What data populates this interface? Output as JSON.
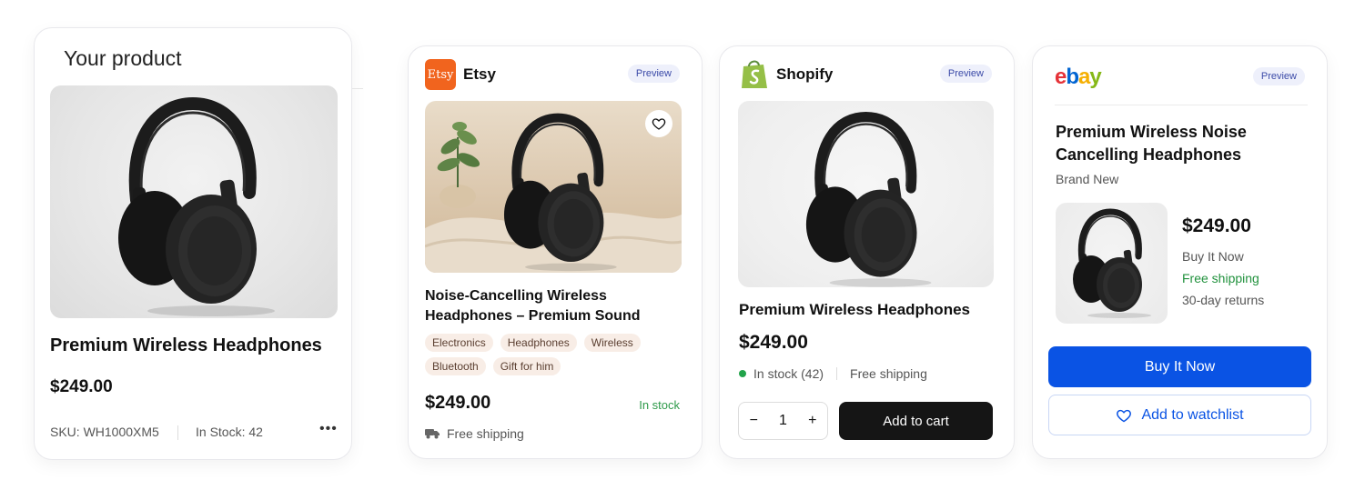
{
  "your_product": {
    "title": "Your product",
    "name": "Premium Wireless Headphones",
    "price": "$249.00",
    "sku": "SKU: WH1000XM5",
    "stock": "In Stock: 42",
    "more_icon": "more-horizontal-icon"
  },
  "etsy": {
    "brand": "Etsy",
    "logo_text": "Etsy",
    "preview": "Preview",
    "name": "Noise-Cancelling Wireless Headphones – Premium Sound",
    "tags": [
      "Electronics",
      "Headphones",
      "Wireless",
      "Bluetooth",
      "Gift for him"
    ],
    "price": "$249.00",
    "stock": "In stock",
    "shipping": "Free shipping",
    "brand_color": "#f1641e"
  },
  "shopify": {
    "brand": "Shopify",
    "preview": "Preview",
    "name": "Premium Wireless Headphones",
    "price": "$249.00",
    "stock": "In stock (42)",
    "shipping": "Free shipping",
    "qty": "1",
    "qty_minus": "−",
    "qty_plus": "+",
    "add_to_cart": "Add to cart",
    "brand_color": "#95bf47"
  },
  "ebay": {
    "logo_letters": [
      "e",
      "b",
      "a",
      "y"
    ],
    "preview": "Preview",
    "name_line1": "Premium Wireless Noise",
    "name_line2": "Cancelling Headphones",
    "condition": "Brand New",
    "price": "$249.00",
    "format": "Buy It Now",
    "shipping": "Free shipping",
    "returns": "30-day returns",
    "buy_now": "Buy It Now",
    "watchlist": "Add to watchlist",
    "accent": "#0a53e4"
  }
}
